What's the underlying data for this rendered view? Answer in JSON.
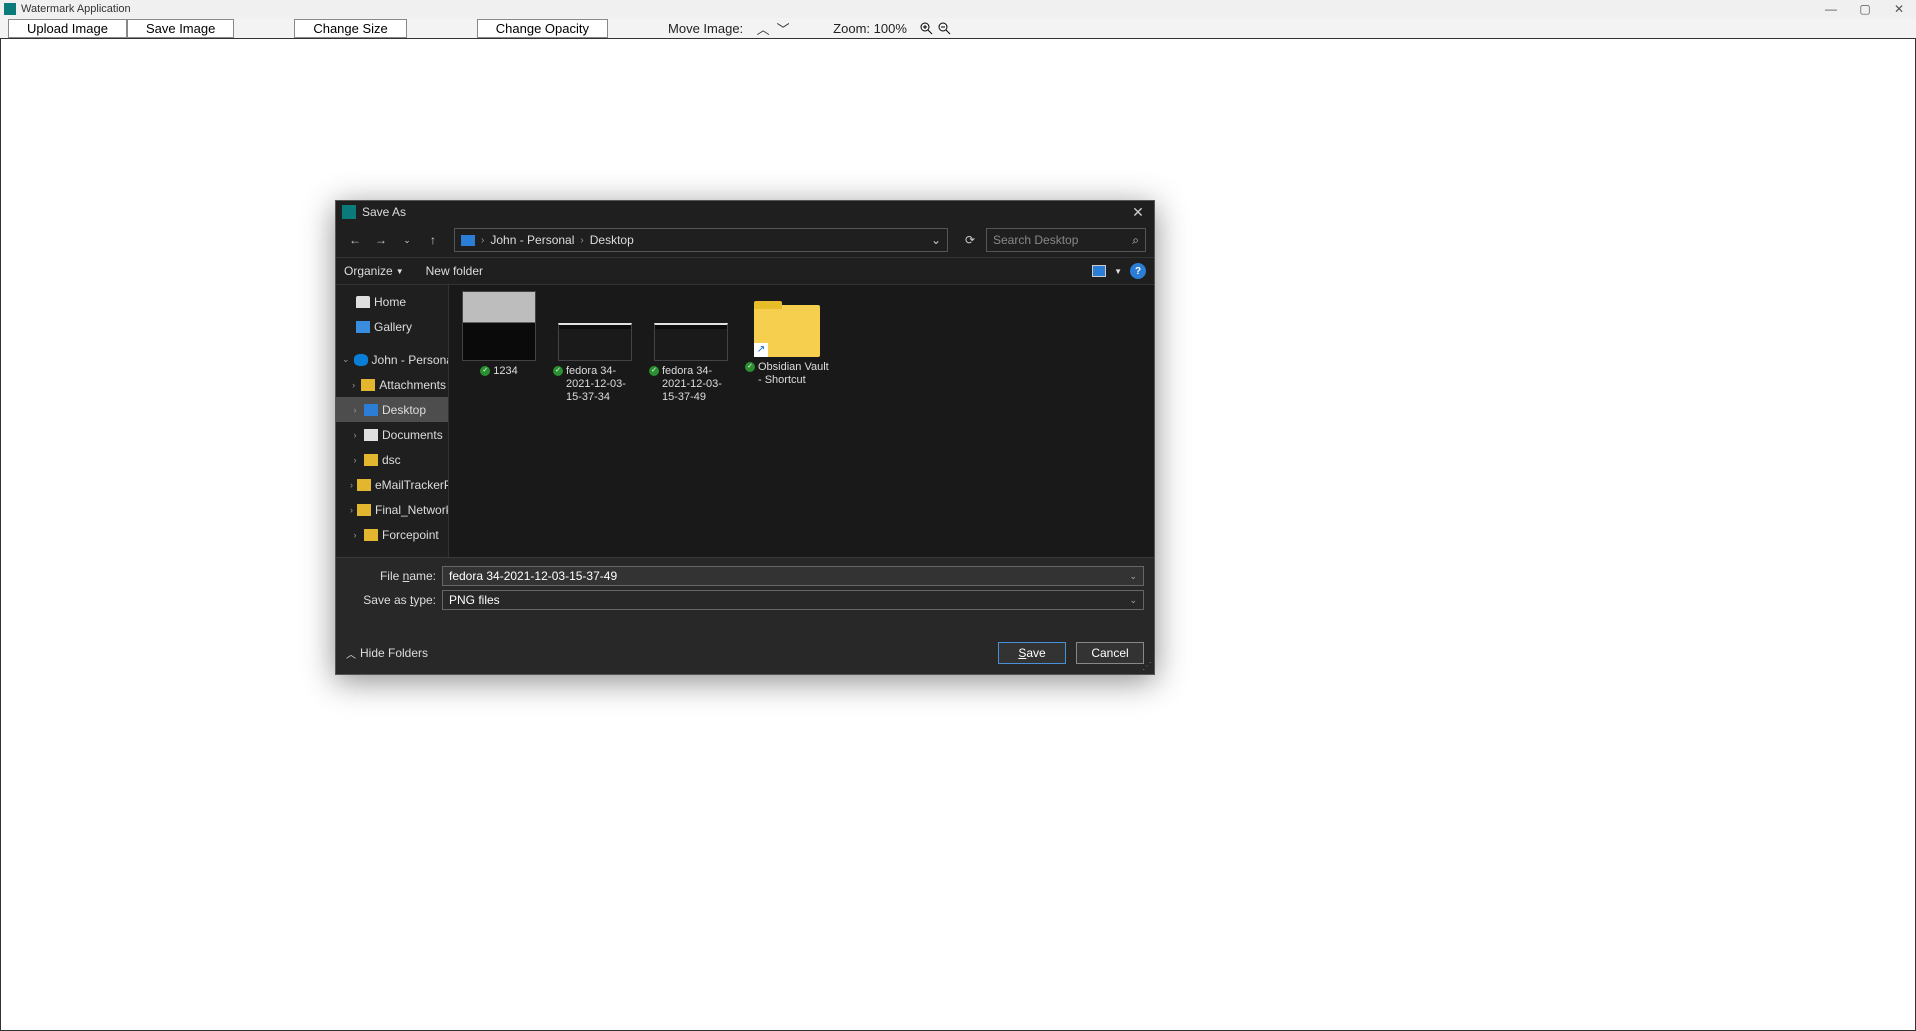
{
  "app": {
    "title": "Watermark Application"
  },
  "toolbar": {
    "upload": "Upload Image",
    "save": "Save Image",
    "change_size": "Change Size",
    "change_opacity": "Change Opacity",
    "move_label": "Move Image:",
    "zoom_label": "Zoom: 100%"
  },
  "dialog": {
    "title": "Save As",
    "breadcrumb": {
      "root": "John - Personal",
      "current": "Desktop"
    },
    "search_placeholder": "Search Desktop",
    "organize": "Organize",
    "new_folder": "New folder",
    "sidebar": {
      "home": "Home",
      "gallery": "Gallery",
      "personal": "John - Personal",
      "attachments": "Attachments",
      "desktop": "Desktop",
      "documents": "Documents",
      "dsc": "dsc",
      "email": "eMailTrackerPro",
      "final": "Final_Network",
      "forcepoint": "Forcepoint"
    },
    "files": {
      "f1": "1234",
      "f2": "fedora 34-2021-12-03-15-37-34",
      "f3": "fedora 34-2021-12-03-15-37-49",
      "f4": "Obsidian Vault - Shortcut"
    },
    "filename_label": "File name:",
    "filename_value": "fedora 34-2021-12-03-15-37-49",
    "savetype_label": "Save as type:",
    "savetype_value": "PNG files",
    "hide_folders": "Hide Folders",
    "save_btn": "Save",
    "cancel_btn": "Cancel"
  }
}
